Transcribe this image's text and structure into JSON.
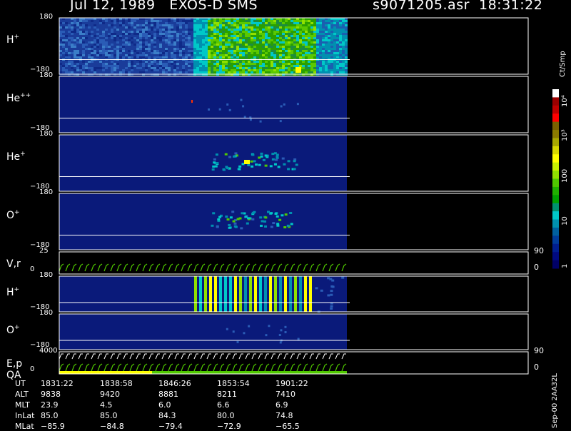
{
  "header": {
    "title": "Jul 12, 1989   EXOS-D SMS",
    "file": "s9071205.asr  18:31:22"
  },
  "colorbar": {
    "units": "Ct/Smp",
    "ticks": [
      "10⁴",
      "10³",
      "100",
      "10",
      "1"
    ],
    "colors": [
      "#ffffff",
      "#9b0000",
      "#c00000",
      "#ff0000",
      "#7a6000",
      "#8a7a00",
      "#a8a800",
      "#d8d800",
      "#ffff00",
      "#c8f000",
      "#90e000",
      "#50c800",
      "#20b000",
      "#00a000",
      "#009070",
      "#00c8c8",
      "#0090b0",
      "#0060a0",
      "#003c9c",
      "#001e90",
      "#000a80",
      "#000066"
    ],
    "colors_note": null
  },
  "chart_data": {
    "type": "heatmap",
    "panels": [
      {
        "id": "h-plus",
        "label_base": "H",
        "label_sup": "+",
        "ytop": "180",
        "ybot": "−180",
        "intensity": "high"
      },
      {
        "id": "he-plus-plus",
        "label_base": "He",
        "label_sup": "++",
        "ytop": "180",
        "ybot": "−180",
        "intensity": "low"
      },
      {
        "id": "he-plus",
        "label_base": "He",
        "label_sup": "+",
        "ytop": "180",
        "ybot": "−180",
        "intensity": "medium"
      },
      {
        "id": "o-plus",
        "label_base": "O",
        "label_sup": "+",
        "ytop": "180",
        "ybot": "−180",
        "intensity": "medium"
      },
      {
        "id": "v-r",
        "label_base": "V,r",
        "label_sup": "",
        "ytop": "25",
        "ybot": "0",
        "right_top": "90",
        "right_bot": "0",
        "kind": "line"
      },
      {
        "id": "h-plus-2",
        "label_base": "H",
        "label_sup": "+",
        "ytop": "180",
        "ybot": "−180",
        "intensity": "bars"
      },
      {
        "id": "o-plus-2",
        "label_base": "O",
        "label_sup": "+",
        "ytop": "180",
        "ybot": "−180",
        "intensity": "low"
      },
      {
        "id": "e-p",
        "label_base": "E,p",
        "label_sup": "",
        "label2": "QA",
        "ytop": "4000",
        "ybot": "0",
        "right_top": "90",
        "right_bot": "0",
        "kind": "line"
      }
    ],
    "x_times": [
      "1831:22",
      "1838:58",
      "1846:26",
      "1853:54",
      "1901:22"
    ]
  },
  "footer": {
    "rows": [
      {
        "label": "UT",
        "values": [
          "1831:22",
          "1838:58",
          "1846:26",
          "1853:54",
          "1901:22"
        ]
      },
      {
        "label": "ALT",
        "values": [
          "9838",
          "9420",
          "8881",
          "8211",
          "7410"
        ]
      },
      {
        "label": "MLT",
        "values": [
          "23.9",
          "4.5",
          "6.0",
          "6.6",
          "6.9"
        ]
      },
      {
        "label": "InLat",
        "values": [
          "85.0",
          "85.0",
          "84.3",
          "80.0",
          "74.8"
        ]
      },
      {
        "label": "MLat",
        "values": [
          "−85.9",
          "−84.8",
          "−79.4",
          "−72.9",
          "−65.5"
        ]
      }
    ],
    "stamp": "Sep-00  2AA32L"
  }
}
